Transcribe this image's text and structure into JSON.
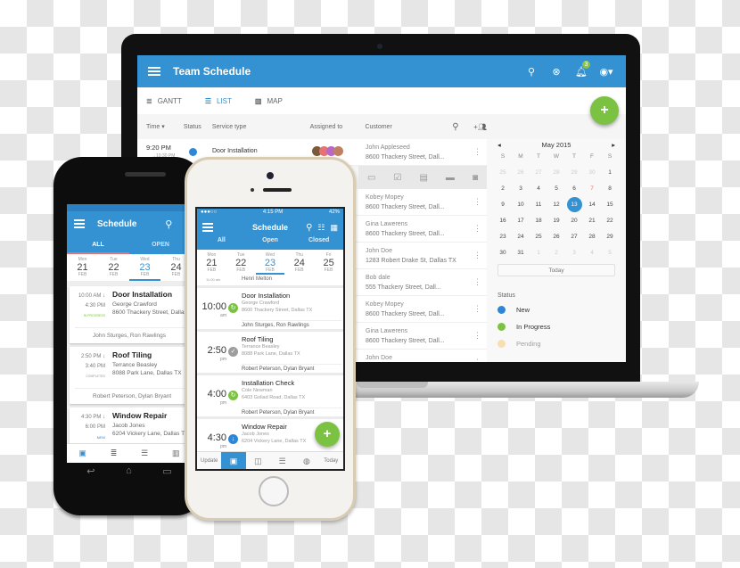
{
  "laptop": {
    "app_title": "Team Schedule",
    "notification_count": "3",
    "view_tabs": [
      {
        "label": "GANTT",
        "icon": "gantt-icon",
        "active": false
      },
      {
        "label": "LIST",
        "icon": "list-icon",
        "active": true
      },
      {
        "label": "MAP",
        "icon": "map-icon",
        "active": false
      }
    ],
    "columns": [
      "Time ▾",
      "Status",
      "Service type",
      "Assigned to",
      "Customer"
    ],
    "first_row": {
      "time": "9:20 PM",
      "time_end": "→10:30 PM",
      "status": "new",
      "service": "Door Installation"
    },
    "action_icons": [
      "comment-icon",
      "checklist-icon",
      "form-icon",
      "payment-icon",
      "camera-icon"
    ],
    "customers": [
      {
        "name": "John Appleseed",
        "address": "8600 Thackery Street, Dall..."
      },
      {
        "name": "Kobey Mopey",
        "address": "8600 Thackery Street, Dall..."
      },
      {
        "name": "Gina Lawerens",
        "address": "8600 Thackery Street, Dall..."
      },
      {
        "name": "John Doe",
        "address": "1283 Robert Drake St, Dallas TX"
      },
      {
        "name": "Bob dale",
        "address": "555 Thackery Street, Dall..."
      },
      {
        "name": "Kobey Mopey",
        "address": "8600 Thackery Street, Dall..."
      },
      {
        "name": "Gina Lawerens",
        "address": "8600 Thackery Street, Dall..."
      },
      {
        "name": "John Doe",
        "address": ""
      }
    ],
    "calendar": {
      "month": "May 2015",
      "weekdays": [
        "S",
        "M",
        "T",
        "W",
        "T",
        "F",
        "S"
      ],
      "days": [
        "25",
        "26",
        "27",
        "28",
        "29",
        "30",
        "1",
        "2",
        "3",
        "4",
        "5",
        "6",
        "7",
        "8",
        "9",
        "10",
        "11",
        "12",
        "13",
        "14",
        "15",
        "16",
        "17",
        "18",
        "19",
        "20",
        "21",
        "22",
        "23",
        "24",
        "25",
        "26",
        "27",
        "28",
        "29",
        "30",
        "31",
        "1",
        "2",
        "3",
        "4",
        "5"
      ],
      "selected": "13",
      "today_label": "Today"
    },
    "status_legend": {
      "title": "Status",
      "items": [
        {
          "label": "New",
          "color": "#2f86d4"
        },
        {
          "label": "In Progress",
          "color": "#7cc242"
        },
        {
          "label": "Pending",
          "color": "#f5c15c"
        }
      ]
    },
    "fab_label": "+"
  },
  "android": {
    "title": "Schedule",
    "tabs": [
      "ALL",
      "OPEN"
    ],
    "days": [
      {
        "dow": "Mon",
        "num": "21",
        "mon": "FEB"
      },
      {
        "dow": "Tue",
        "num": "22",
        "mon": "FEB"
      },
      {
        "dow": "Wed",
        "num": "23",
        "mon": "FEB"
      },
      {
        "dow": "Thu",
        "num": "24",
        "mon": "FEB"
      }
    ],
    "jobs": [
      {
        "start": "10:00 AM ↓",
        "end": "4:30 PM",
        "status": "IN PROGRESS",
        "title": "Door Installation",
        "customer": "George Crawford",
        "address": "8600 Thackery Street, Dallas",
        "crew": "John Sturges, Ron Rawlings"
      },
      {
        "start": "2:50 PM ↓",
        "end": "3:40 PM",
        "status": "COMPLETED",
        "title": "Roof Tiling",
        "customer": "Terrance Beasley",
        "address": "8088 Park Lane, Dallas TX",
        "crew": "Robert Peterson, Dylan Bryant"
      },
      {
        "start": "4:30 PM ↓",
        "end": "6:00 PM",
        "status": "NEW",
        "title": "Window Repair",
        "customer": "Jacob Jones",
        "address": "6204 Vickery Lane, Dallas TX",
        "crew": ""
      }
    ]
  },
  "iphone": {
    "carrier": "●●●○○",
    "time": "4:15 PM",
    "battery": "42%",
    "title": "Schedule",
    "tabs": [
      "All",
      "Open",
      "Closed"
    ],
    "days": [
      {
        "dow": "Mon",
        "num": "21",
        "mon": "FEB"
      },
      {
        "dow": "Tue",
        "num": "22",
        "mon": "FEB"
      },
      {
        "dow": "Wed",
        "num": "23",
        "mon": "FEB"
      },
      {
        "dow": "Thu",
        "num": "24",
        "mon": "FEB"
      },
      {
        "dow": "Fri",
        "num": "25",
        "mon": "FEB"
      }
    ],
    "prev_entry": {
      "time": "11:00 am",
      "name": "Henri Melton"
    },
    "jobs": [
      {
        "time": "10:00",
        "ampm": "am",
        "status": "in-progress",
        "title": "Door Installation",
        "customer": "George Crawford",
        "address": "8600 Thackery Street, Dallas TX",
        "crew": "John Sturges, Ron Rawlings"
      },
      {
        "time": "2:50",
        "ampm": "pm",
        "status": "completed",
        "title": "Roof Tiling",
        "customer": "Terrance Beasley",
        "address": "8088 Park Lane, Dallas TX",
        "crew": "Robert Peterson, Dylan Bryant"
      },
      {
        "time": "4:00",
        "ampm": "pm",
        "status": "in-progress",
        "title": "Installation Check",
        "customer": "Cole Newman",
        "address": "6403 Goliad Road, Dallas TX",
        "crew": "Robert Peterson, Dylan Bryant"
      },
      {
        "time": "4:30",
        "ampm": "pm",
        "status": "new",
        "title": "Window Repair",
        "customer": "Jacob Jones",
        "address": "6204 Vickery Lane, Dallas TX",
        "crew": ""
      }
    ],
    "nav": {
      "update": "Update",
      "today": "Today"
    },
    "fab_label": "+"
  },
  "colors": {
    "brand_blue": "#3592d2",
    "accent_green": "#7cc242"
  }
}
